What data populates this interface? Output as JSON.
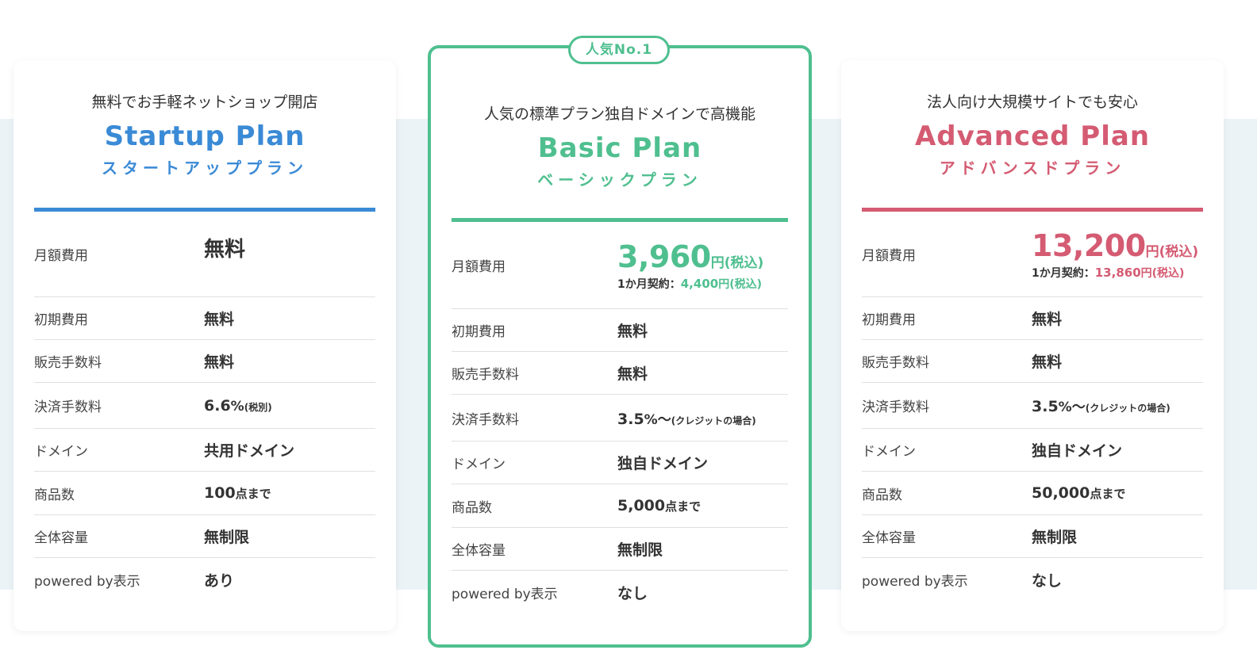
{
  "colors": {
    "startup": "#3a8ad6",
    "basic": "#4fbf8f",
    "advanced": "#d45b72",
    "band": "#ebf3f7"
  },
  "labels": {
    "monthly": "月額費用",
    "initial": "初期費用",
    "sales_fee": "販売手数料",
    "payment_fee": "決済手数料",
    "domain": "ドメイン",
    "products": "商品数",
    "storage": "全体容量",
    "powered_by": "powered by表示"
  },
  "startup": {
    "tagline": "無料でお手軽ネットショップ開店",
    "name": "Startup Plan",
    "kana": "スタートアッププラン",
    "monthly": "無料",
    "initial": "無料",
    "sales_fee": "無料",
    "payment_fee": {
      "num": "6.6",
      "unit": "%",
      "note": "(税別)"
    },
    "domain": "共用ドメイン",
    "products": {
      "num": "100",
      "unit": "点まで"
    },
    "storage": "無制限",
    "powered_by": "あり"
  },
  "basic": {
    "badge": "人気No.1",
    "tagline": "人気の標準プラン独自ドメインで高機能",
    "name": "Basic Plan",
    "kana": "ベーシックプラン",
    "monthly": {
      "price": "3,960",
      "unit": "円",
      "tax": "(税込)",
      "sub_prefix": "1か月契約：",
      "sub_price": "4,400",
      "sub_unit": "円",
      "sub_tax": "(税込)"
    },
    "initial": "無料",
    "sales_fee": "無料",
    "payment_fee": {
      "num": "3.5",
      "unit": "%〜",
      "note": "(クレジットの場合)"
    },
    "domain": "独自ドメイン",
    "products": {
      "num": "5,000",
      "unit": "点まで"
    },
    "storage": "無制限",
    "powered_by": "なし"
  },
  "advanced": {
    "tagline": "法人向け大規模サイトでも安心",
    "name": "Advanced Plan",
    "kana": "アドバンスドプラン",
    "monthly": {
      "price": "13,200",
      "unit": "円",
      "tax": "(税込)",
      "sub_prefix": "1か月契約：",
      "sub_price": "13,860",
      "sub_unit": "円",
      "sub_tax": "(税込)"
    },
    "initial": "無料",
    "sales_fee": "無料",
    "payment_fee": {
      "num": "3.5",
      "unit": "%〜",
      "note": "(クレジットの場合)"
    },
    "domain": "独自ドメイン",
    "products": {
      "num": "50,000",
      "unit": "点まで"
    },
    "storage": "無制限",
    "powered_by": "なし"
  }
}
